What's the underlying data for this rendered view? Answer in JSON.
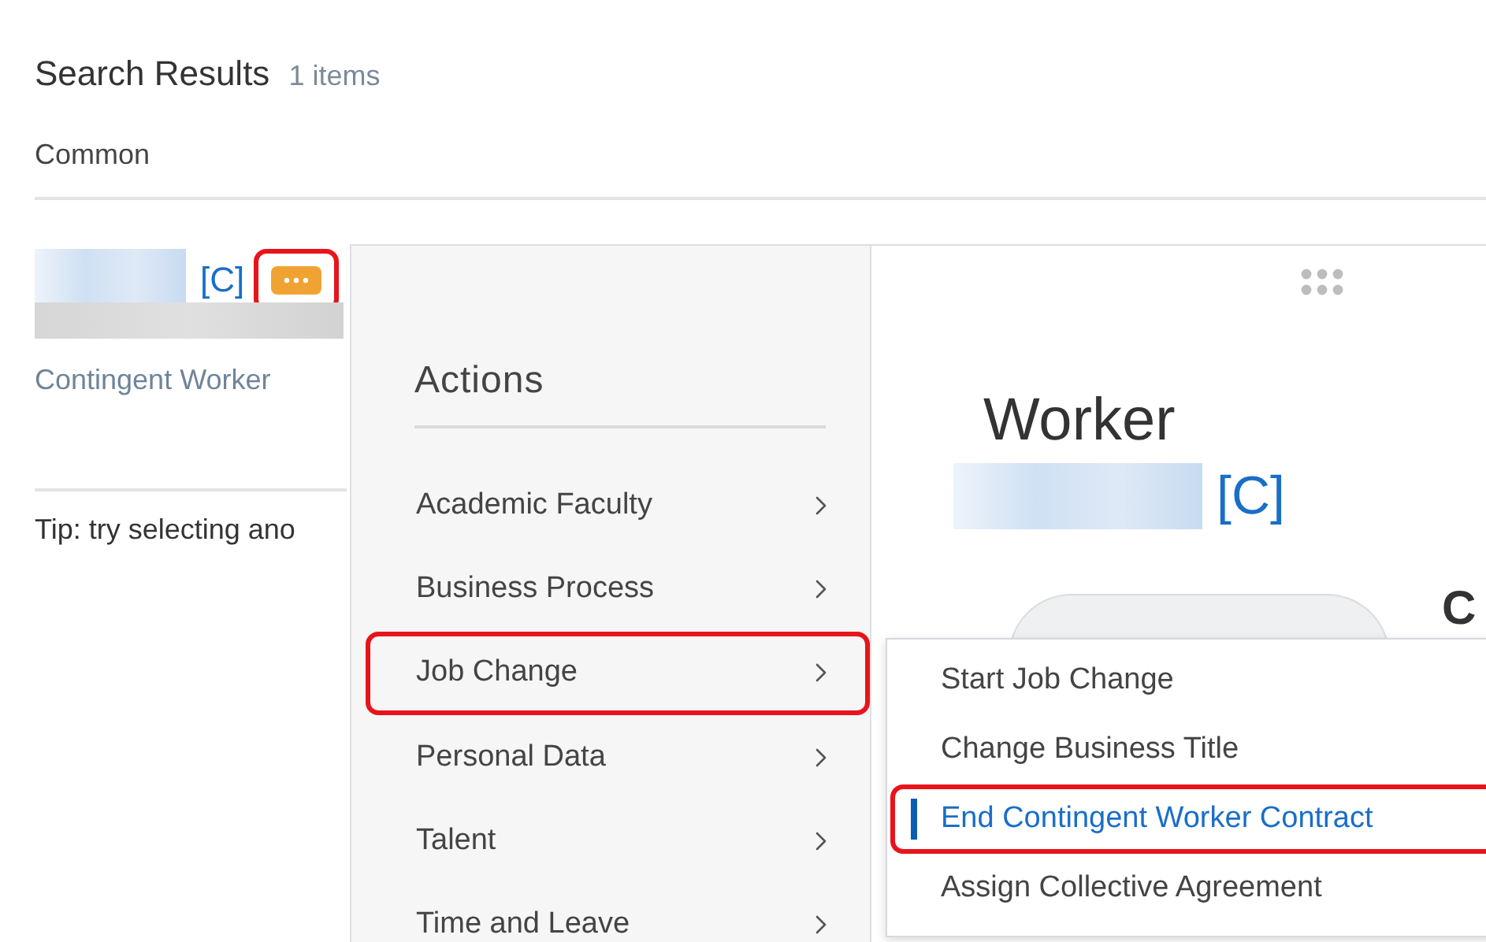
{
  "search_results": {
    "title": "Search Results",
    "count": "1 items",
    "category": "Common",
    "result": {
      "link": "[C]",
      "subtitle": "Contingent Worker",
      "actions_highlighted": true
    },
    "tip": "Tip: try selecting ano"
  },
  "actions_menu": {
    "title": "Actions",
    "items": [
      {
        "label": "Academic Faculty",
        "highlighted": false
      },
      {
        "label": "Business Process",
        "highlighted": false
      },
      {
        "label": "Job Change",
        "highlighted": true
      },
      {
        "label": "Personal Data",
        "highlighted": false
      },
      {
        "label": "Talent",
        "highlighted": false
      },
      {
        "label": "Time and Leave",
        "highlighted": false
      }
    ]
  },
  "submenu": {
    "items": [
      {
        "label": "Start Job Change",
        "selected": false,
        "highlighted": false
      },
      {
        "label": "Change Business Title",
        "selected": false,
        "highlighted": false
      },
      {
        "label": "End Contingent Worker Contract",
        "selected": true,
        "highlighted": true
      },
      {
        "label": "Assign Collective Agreement",
        "selected": false,
        "highlighted": false
      }
    ]
  },
  "worker_card": {
    "title": "Worker",
    "link": "[C]",
    "heading_fragment": "C"
  }
}
